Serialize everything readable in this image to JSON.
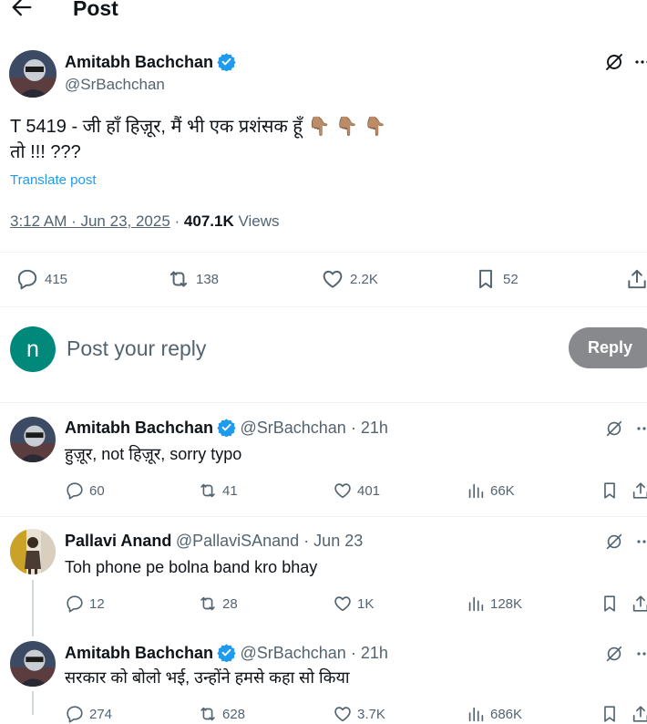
{
  "header": {
    "title": "Post"
  },
  "post": {
    "author_name": "Amitabh Bachchan",
    "author_handle": "@SrBachchan",
    "text_line1": "T 5419 - जी हाँ हिज़ूर, मैं भी एक प्रशंसक हूँ",
    "text_emoji": "👇🏽👇🏽👇🏽",
    "text_line2": "तो  !!! ???",
    "translate_label": "Translate post",
    "timestamp": "3:12 AM · Jun 23, 2025",
    "separator": " · ",
    "views_count": "407.1K",
    "views_label": " Views",
    "stats": {
      "replies": "415",
      "reposts": "138",
      "likes": "2.2K",
      "bookmarks": "52"
    }
  },
  "reply_box": {
    "avatar_letter": "n",
    "placeholder": "Post your reply",
    "button_label": "Reply"
  },
  "replies": [
    {
      "name": "Amitabh Bachchan",
      "handle": "@SrBachchan",
      "time": " · 21h",
      "text": "हुज़ूर, not हिज़ूर, sorry typo",
      "replies": "60",
      "reposts": "41",
      "likes": "401",
      "views": "66K"
    },
    {
      "name": "Pallavi Anand",
      "handle": "@PallaviSAnand",
      "time": " · Jun 23",
      "text": "Toh phone pe bolna band kro bhay",
      "replies": "12",
      "reposts": "28",
      "likes": "1K",
      "views": "128K"
    },
    {
      "name": "Amitabh Bachchan",
      "handle": "@SrBachchan",
      "time": " · 21h",
      "text": "सरकार को बोलो भई, उन्होंने हमसे कहा सो किया",
      "replies": "274",
      "reposts": "628",
      "likes": "3.7K",
      "views": "686K"
    }
  ],
  "colors": {
    "accent": "#1d9bf0",
    "reply_avatar": "#00897b",
    "reply_button": "#87898c"
  }
}
